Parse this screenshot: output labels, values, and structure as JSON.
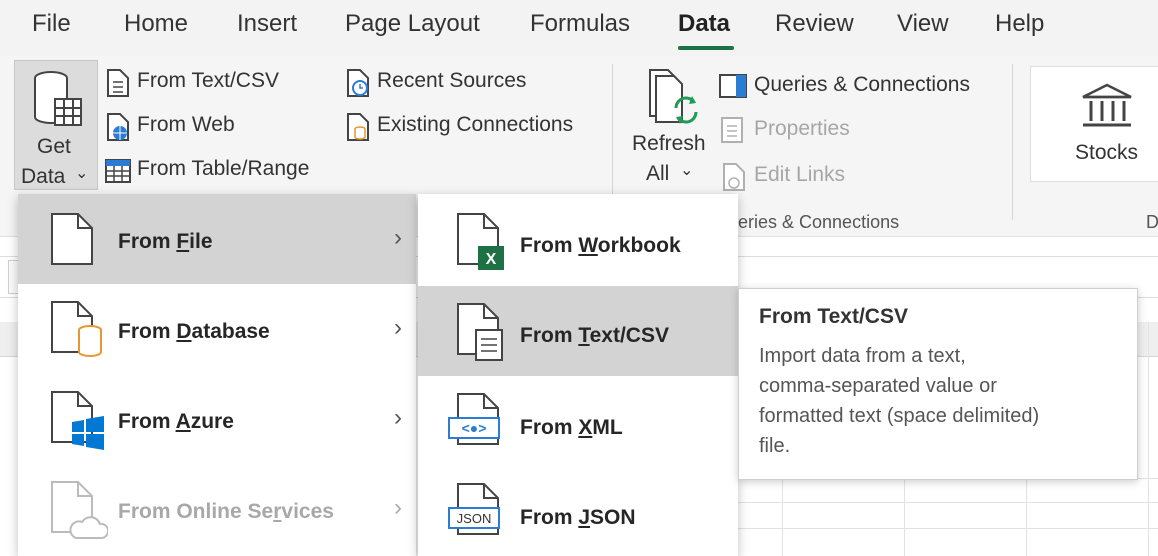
{
  "tabs": [
    "File",
    "Home",
    "Insert",
    "Page Layout",
    "Formulas",
    "Data",
    "Review",
    "View",
    "Help"
  ],
  "active_tab": "Data",
  "ribbon": {
    "get_data": {
      "line1": "Get",
      "line2": "Data"
    },
    "from_text_csv": "From Text/CSV",
    "from_web": "From Web",
    "from_table_range": "From Table/Range",
    "recent_sources": "Recent Sources",
    "existing_connections": "Existing Connections",
    "refresh": {
      "line1": "Refresh",
      "line2": "All"
    },
    "queries_connections": "Queries & Connections",
    "properties": "Properties",
    "edit_links": "Edit Links",
    "group_label_partial": "eries & Connections",
    "stocks": "Stocks",
    "edge_letter": "D"
  },
  "menu_main": [
    {
      "pre": "From ",
      "key": "F",
      "post": "ile",
      "icon": "file-icon",
      "disabled": false,
      "highlighted": true
    },
    {
      "pre": "From ",
      "key": "D",
      "post": "atabase",
      "icon": "database-icon",
      "disabled": false,
      "highlighted": false
    },
    {
      "pre": "From ",
      "key": "A",
      "post": "zure",
      "icon": "azure-icon",
      "disabled": false,
      "highlighted": false
    },
    {
      "pre": "From Online Se",
      "key": "r",
      "post": "vices",
      "icon": "cloud-icon",
      "disabled": true,
      "highlighted": false
    }
  ],
  "menu_sub": [
    {
      "pre": "From ",
      "key": "W",
      "post": "orkbook",
      "icon": "excel-workbook-icon",
      "highlighted": false
    },
    {
      "pre": "From ",
      "key": "T",
      "post": "ext/CSV",
      "icon": "text-file-icon",
      "highlighted": true
    },
    {
      "pre": "From ",
      "key": "X",
      "post": "ML",
      "icon": "xml-icon",
      "highlighted": false
    },
    {
      "pre": "From ",
      "key": "J",
      "post": "SON",
      "icon": "json-icon",
      "highlighted": false
    }
  ],
  "tooltip": {
    "title": "From Text/CSV",
    "lines": [
      "Import data from a text,",
      "comma-separated value or",
      "formatted text (space delimited)",
      "file."
    ]
  },
  "colors": {
    "accent": "#1e7145",
    "excel_green": "#1e7145",
    "azure_blue": "#0078d4",
    "db_orange": "#e8962e",
    "highlight": "#d3d3d3"
  }
}
